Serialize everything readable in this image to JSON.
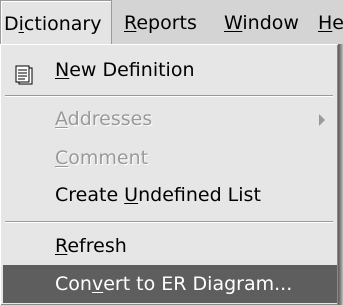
{
  "menubar": {
    "items": [
      {
        "label": "Dictionary",
        "mnemonic": "i"
      },
      {
        "label": "Reports",
        "mnemonic": "R"
      },
      {
        "label": "Window",
        "mnemonic": "W"
      },
      {
        "label": "He",
        "mnemonic": "H"
      }
    ],
    "active": "Dictionary"
  },
  "dropdown": {
    "items": [
      {
        "label": "New Definition",
        "mnemonic": "N",
        "icon": "new-definition-icon",
        "enabled": true
      },
      {
        "label": "Addresses",
        "mnemonic": "A",
        "enabled": false,
        "submenu": true
      },
      {
        "label": "Comment",
        "mnemonic": "C",
        "enabled": false
      },
      {
        "label": "Create Undefined List",
        "mnemonic": "U",
        "enabled": true
      },
      {
        "label": "Refresh",
        "mnemonic": "R",
        "enabled": true
      },
      {
        "label": "Convert to ER Diagram...",
        "mnemonic": "v",
        "enabled": true,
        "highlighted": true
      }
    ]
  },
  "colors": {
    "menu_bg": "#e6e6e6",
    "highlight_bg": "#5e5e5e",
    "disabled_text": "#9a9a9a"
  }
}
